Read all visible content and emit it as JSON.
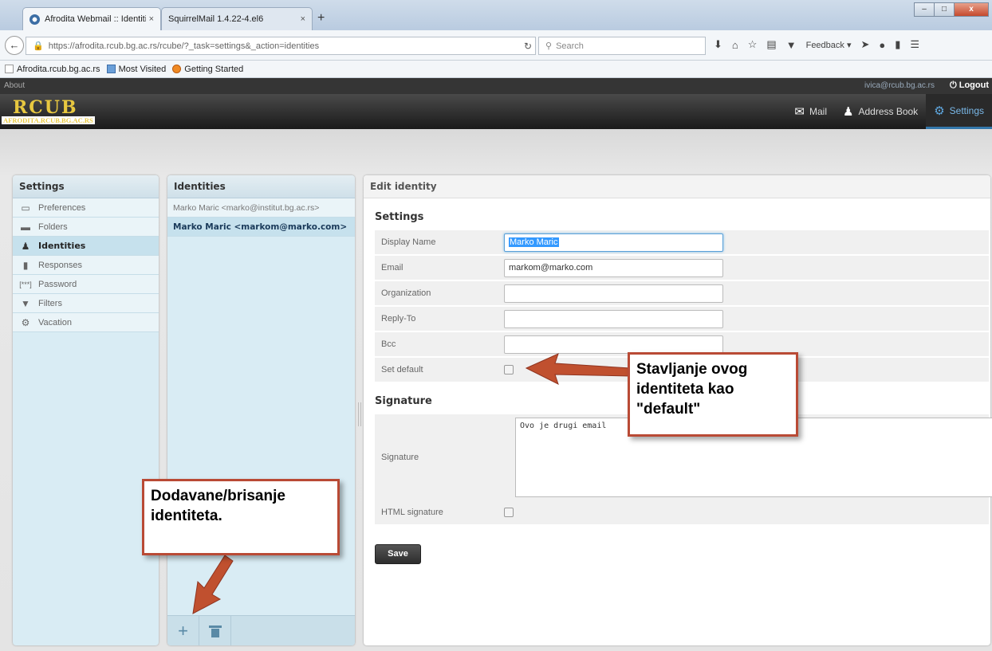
{
  "browser": {
    "tabs": [
      {
        "title": "Afrodita Webmail :: Identiti...",
        "close": "×"
      },
      {
        "title": "SquirrelMail 1.4.22-4.el6",
        "close": "×"
      }
    ],
    "new_tab": "+",
    "url": "https://afrodita.rcub.bg.ac.rs/rcube/?_task=settings&_action=identities",
    "search_placeholder": "Search",
    "feedback_label": "Feedback ▾",
    "bookmarks": [
      {
        "label": "Afrodita.rcub.bg.ac.rs"
      },
      {
        "label": "Most Visited"
      },
      {
        "label": "Getting Started"
      }
    ]
  },
  "app": {
    "about": "About",
    "user_email": "ivica@rcub.bg.ac.rs",
    "logout": "Logout",
    "logo_text": "RCUB",
    "logo_subtext": "AFRODITA.RCUB.BG.AC.RS",
    "tasks": [
      {
        "label": "Mail",
        "icon": "envelope-icon"
      },
      {
        "label": "Address Book",
        "icon": "person-icon"
      },
      {
        "label": "Settings",
        "icon": "gear-icon"
      }
    ]
  },
  "settings_panel": {
    "title": "Settings",
    "items": [
      {
        "label": "Preferences"
      },
      {
        "label": "Folders"
      },
      {
        "label": "Identities"
      },
      {
        "label": "Responses"
      },
      {
        "label": "Password"
      },
      {
        "label": "Filters"
      },
      {
        "label": "Vacation"
      }
    ]
  },
  "identities_panel": {
    "title": "Identities",
    "items": [
      {
        "label": "Marko Maric <marko@institut.bg.ac.rs>"
      },
      {
        "label": "Marko Maric <markom@marko.com>"
      }
    ],
    "add_button": "+",
    "delete_button": "🗑"
  },
  "edit_panel": {
    "title": "Edit identity",
    "settings_section": "Settings",
    "fields": {
      "display_name": {
        "label": "Display Name",
        "value": "Marko Maric"
      },
      "email": {
        "label": "Email",
        "value": "markom@marko.com"
      },
      "organization": {
        "label": "Organization",
        "value": ""
      },
      "reply_to": {
        "label": "Reply-To",
        "value": ""
      },
      "bcc": {
        "label": "Bcc",
        "value": ""
      },
      "set_default": {
        "label": "Set default"
      }
    },
    "signature_section": "Signature",
    "signature": {
      "label": "Signature",
      "value": "Ovo je drugi email"
    },
    "html_signature": {
      "label": "HTML signature"
    },
    "save_label": "Save"
  },
  "annotations": {
    "default_note": "Stavljanje ovog identiteta kao \"default\"",
    "identities_note": "Dodavane/brisanje identiteta."
  },
  "colors": {
    "callout_border": "#b94a35",
    "arrow": "#c0502f",
    "panel_header": "#cfe0e9",
    "accent": "#37a"
  }
}
